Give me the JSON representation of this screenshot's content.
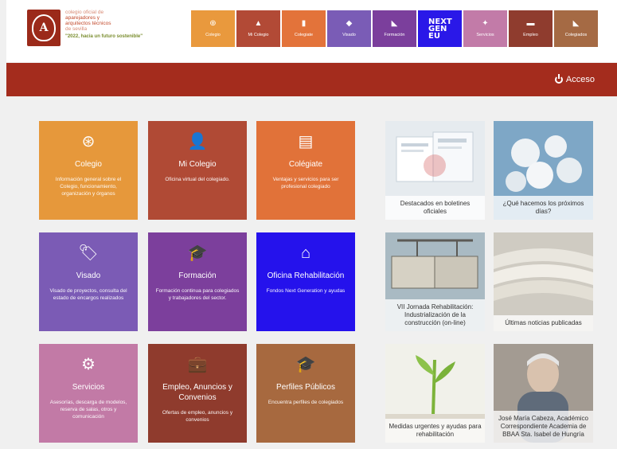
{
  "header": {
    "org_lines": [
      "colegio oficial de",
      "aparejadores y",
      "arquitectos técnicos",
      "de sevilla"
    ],
    "slogan": "\"2022, hacia un futuro sostenible\"",
    "logo_icon": "crest-icon"
  },
  "topnav": [
    {
      "label": "Colegio",
      "icon": "⊕",
      "color": "#e9993d"
    },
    {
      "label": "Mi Colegio",
      "icon": "▲",
      "color": "#b24a36"
    },
    {
      "label": "Colegiate",
      "icon": "▮",
      "color": "#e3733a"
    },
    {
      "label": "Visado",
      "icon": "◆",
      "color": "#7a5cb6"
    },
    {
      "label": "Formación",
      "icon": "◣",
      "color": "#7b3f9c"
    },
    {
      "label": "NEXT GEN EU",
      "icon": "",
      "color": "#2a18e8"
    },
    {
      "label": "Servicios",
      "icon": "✦",
      "color": "#c27ba8"
    },
    {
      "label": "Empleo",
      "icon": "▬",
      "color": "#8f3c2e"
    },
    {
      "label": "Colegiados",
      "icon": "◣",
      "color": "#a56a44"
    }
  ],
  "redbar": {
    "access_label": "Acceso"
  },
  "tiles": [
    {
      "title": "Colegio",
      "desc": "Información general sobre el Colegio, funcionamiento, organización y órganos",
      "icon": "⊛",
      "color": "#e6983b"
    },
    {
      "title": "Mi Colegio",
      "desc": "Oficina virtual del colegiado.",
      "icon": "👤",
      "color": "#b04a35"
    },
    {
      "title": "Colégiate",
      "desc": "Ventajas y servicios para ser profesional colegiado",
      "icon": "▤",
      "color": "#e17239"
    },
    {
      "title": "Visado",
      "desc": "Visado de proyectos, consulta del estado de encargos realizados",
      "icon": "🏷",
      "color": "#7b5bb5"
    },
    {
      "title": "Formación",
      "desc": "Formación continua para colegiados y trabajadores del sector.",
      "icon": "🎓",
      "color": "#7c3f9c"
    },
    {
      "title": "Oficina Rehabilitación",
      "desc": "Fondos Next Generation y ayudas",
      "icon": "⌂",
      "color": "#2512ec"
    },
    {
      "title": "Servicios",
      "desc": "Asesorías, descarga de modelos, reserva de salas, otros y comunicación",
      "icon": "⚙",
      "color": "#c27aa6"
    },
    {
      "title": "Empleo, Anuncios y Convenios",
      "desc": "Ofertas de empleo, anuncios y convenios",
      "icon": "💼",
      "color": "#8f3b2d"
    },
    {
      "title": "Perfiles Públicos",
      "desc": "Encuentra perfiles de colegiados",
      "icon": "🎓",
      "color": "#a7693f"
    }
  ],
  "cards": [
    {
      "caption": "Destacados en boletines oficiales",
      "bg": "#e3e8ee"
    },
    {
      "caption": "¿Qué hacemos los próximos días?",
      "bg": "#7fa8c7"
    },
    {
      "caption": "VII Jornada Rehabilitación: Industrialización de la construcción (on-line)",
      "bg": "#9fb0b8"
    },
    {
      "caption": "Últimas noticias publicadas",
      "bg": "#c9c6bc"
    },
    {
      "caption": "Medidas urgentes y ayudas para rehabilitación",
      "bg": "#f2f2ec"
    },
    {
      "caption": "José María Cabeza, Académico Correspondiente Academia de BBAA Sta. Isabel de Hungría",
      "bg": "#a59d95"
    }
  ]
}
